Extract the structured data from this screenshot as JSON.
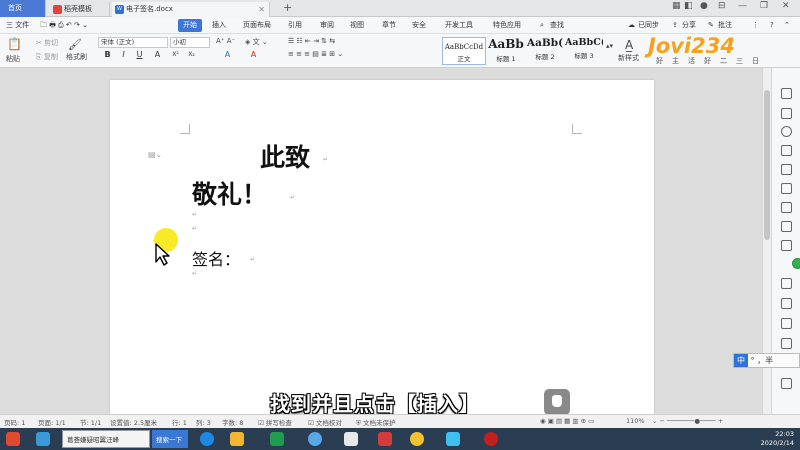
{
  "tabs": {
    "home": "首页",
    "template": "稻壳模板",
    "document": "电子签名.docx",
    "new_tab": "+"
  },
  "menu": {
    "file": "三 文件",
    "items": [
      "开始",
      "插入",
      "页面布局",
      "引用",
      "审阅",
      "视图",
      "章节",
      "安全",
      "开发工具",
      "特色应用"
    ],
    "search": "查找",
    "sync": "已同步",
    "share": "分享",
    "comment": "批注"
  },
  "ribbon": {
    "paste": "粘贴",
    "cut": "剪切",
    "copy": "复制",
    "format_painter": "格式刷",
    "font_name": "宋体 (正文)",
    "font_size": "小初",
    "format_buttons": [
      "B",
      "I",
      "U",
      "A",
      "X²",
      "X₂",
      "A",
      "A"
    ],
    "styles": [
      {
        "preview": "AaBbCcDd",
        "label": "正文"
      },
      {
        "preview": "AaBb",
        "label": "标题 1"
      },
      {
        "preview": "AaBb(",
        "label": "标题 2"
      },
      {
        "preview": "AaBbC(",
        "label": "标题 3"
      }
    ],
    "new_style": "新样式"
  },
  "logo": {
    "brand": "Jovi234",
    "tagline": "好主活好二三日"
  },
  "document": {
    "line1": "此致",
    "line2": "敬礼！",
    "line3": "签名："
  },
  "subtitle": "找到并且点击【插入】",
  "ime": {
    "mode": "中",
    "extra": "° ，半"
  },
  "status": {
    "page_num": "页码: 1",
    "pages": "页面: 1/1",
    "section": "节: 1/1",
    "setting": "设置值: 2.5厘米",
    "row": "行: 1",
    "col": "列: 3",
    "words": "字数: 8",
    "spell": "拼写检查",
    "proof": "文档校对",
    "protect": "文档未保护",
    "zoom": "110%"
  },
  "taskbar": {
    "app_label": "葛荟嫌疑昭翼汪峰",
    "search_label": "搜索一下",
    "time": "22:03",
    "date": "2020/2/14"
  },
  "colors": {
    "accent": "#3c77d8",
    "logo_orange": "#f7a21b",
    "cursor_highlight": "#f7e600",
    "taskbar": "#2b3d52"
  }
}
